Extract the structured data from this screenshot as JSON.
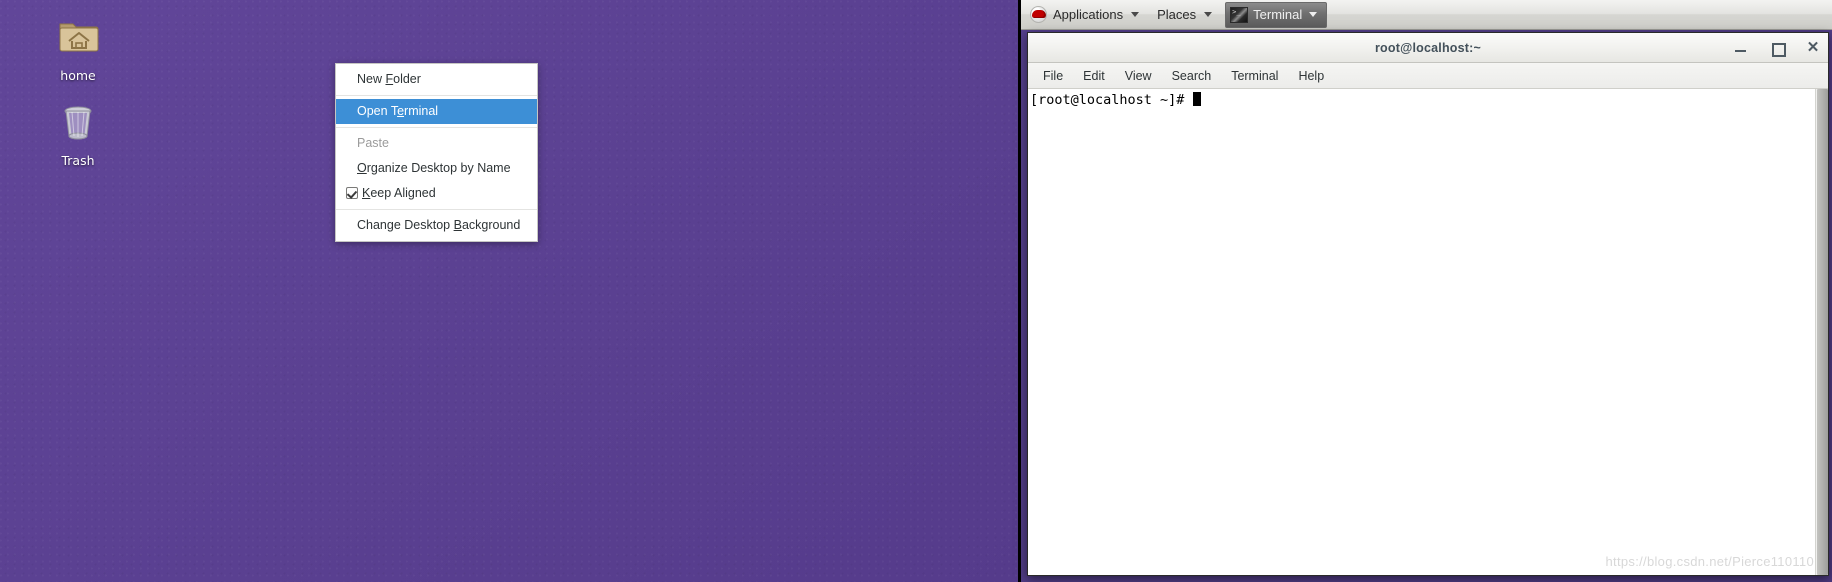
{
  "desktop": {
    "background_color": "#5c4295",
    "icons": [
      {
        "id": "home",
        "label": "home",
        "icon": "home-folder-icon"
      },
      {
        "id": "trash",
        "label": "Trash",
        "icon": "trash-can-icon"
      }
    ]
  },
  "context_menu": {
    "highlight_color": "#3d8fd6",
    "items": [
      {
        "label": "New Folder",
        "mnemonic": "F",
        "state": "normal",
        "type": "item"
      },
      {
        "type": "separator"
      },
      {
        "label": "Open Terminal",
        "mnemonic": "T",
        "state": "highlighted",
        "type": "item"
      },
      {
        "type": "separator"
      },
      {
        "label": "Paste",
        "mnemonic": "",
        "state": "disabled",
        "type": "item"
      },
      {
        "label": "Organize Desktop by Name",
        "mnemonic": "O",
        "state": "normal",
        "type": "item"
      },
      {
        "label": "Keep Aligned",
        "mnemonic": "K",
        "state": "normal",
        "type": "checkitem",
        "checked": true
      },
      {
        "type": "separator"
      },
      {
        "label": "Change Desktop Background",
        "mnemonic": "B",
        "state": "normal",
        "type": "item"
      }
    ]
  },
  "panel": {
    "logo_icon": "redhat-logo-icon",
    "applications_label": "Applications",
    "places_label": "Places",
    "task": {
      "label": "Terminal",
      "icon": "terminal-icon"
    }
  },
  "terminal_window": {
    "title": "root@localhost:~",
    "controls": {
      "minimize": "minimize-icon",
      "maximize": "maximize-icon",
      "close": "close-icon",
      "close_glyph": "✕"
    },
    "menus": [
      "File",
      "Edit",
      "View",
      "Search",
      "Terminal",
      "Help"
    ],
    "content": {
      "prompt": "[root@localhost ~]# ",
      "cursor_visible": true
    }
  },
  "watermark": {
    "text": "https://blog.csdn.net/Pierce110110"
  }
}
